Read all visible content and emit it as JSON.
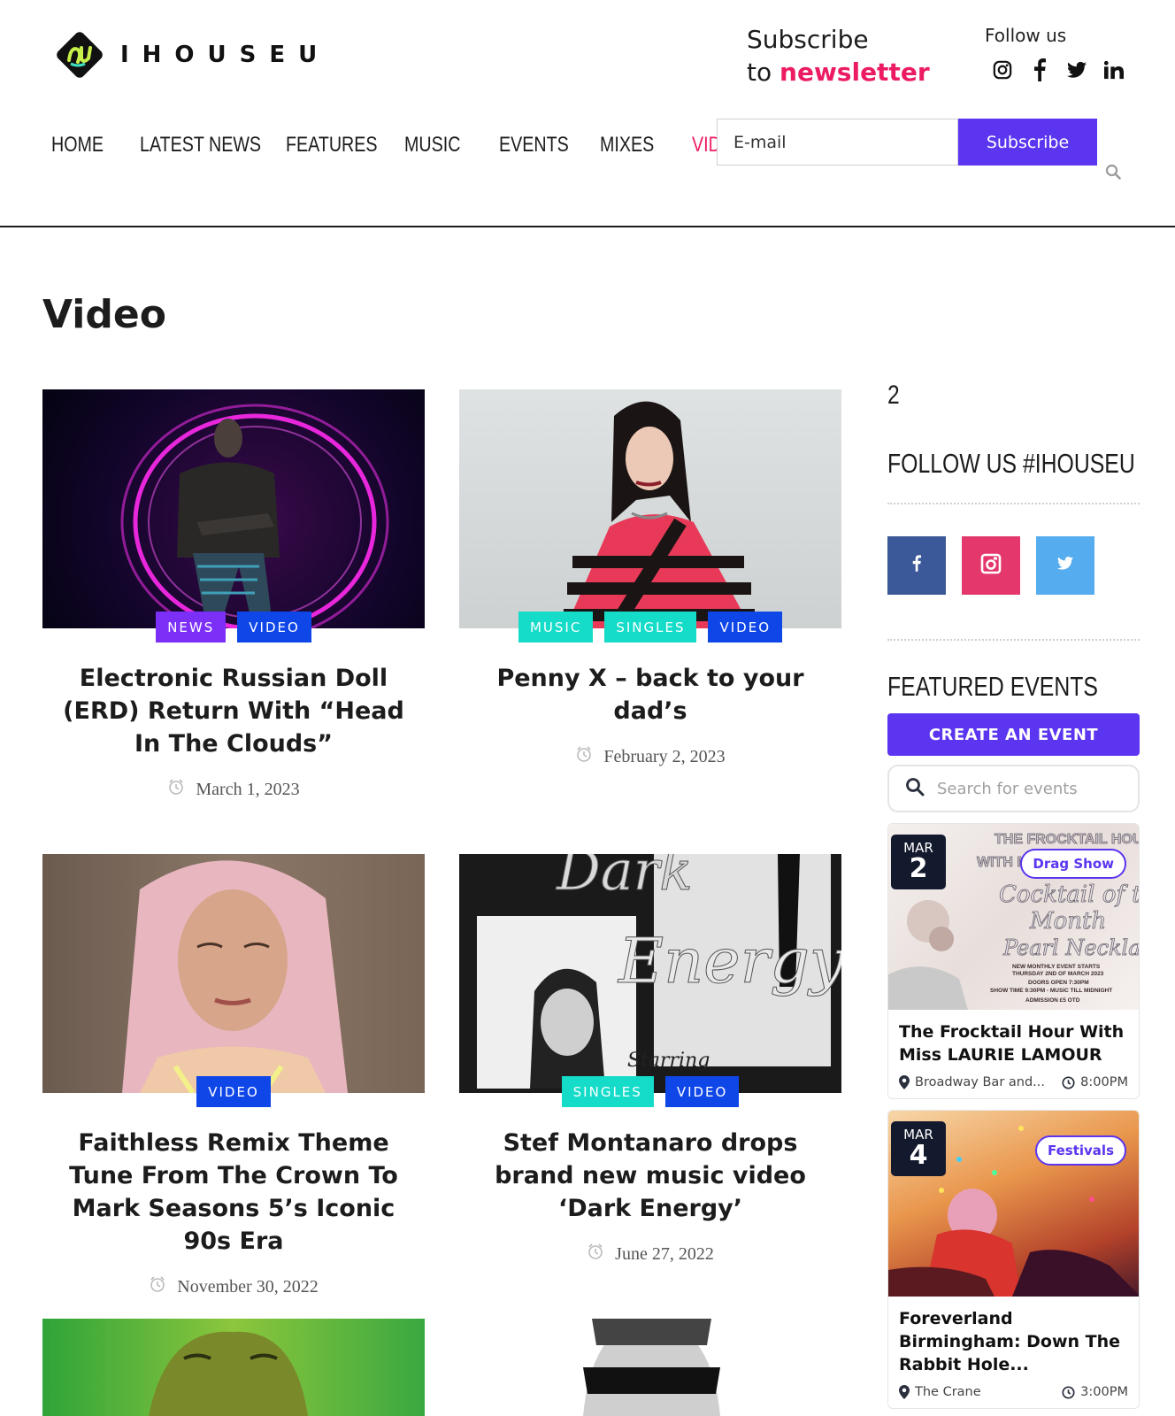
{
  "site": {
    "logo_text": "IHOUSEU"
  },
  "newsletter": {
    "line1": "Subscribe",
    "line2_prefix": "to ",
    "line2_accent": "newsletter",
    "email_placeholder": "E-mail",
    "button_label": "Subscribe"
  },
  "follow": {
    "label": "Follow us",
    "icons": [
      "instagram-icon",
      "facebook-icon",
      "twitter-icon",
      "linkedin-icon"
    ]
  },
  "nav": {
    "items": [
      "HOME",
      "LATEST NEWS",
      "FEATURES",
      "MUSIC",
      "EVENTS",
      "MIXES",
      "VID"
    ],
    "active": "VID"
  },
  "page": {
    "title": "Video"
  },
  "articles": [
    {
      "title": "Electronic Russian Doll (ERD) Return With “Head In The Clouds”",
      "date": "March 1, 2023",
      "tags": [
        "NEWS",
        "VIDEO"
      ]
    },
    {
      "title": "Penny X – back to your dad’s",
      "date": "February 2, 2023",
      "tags": [
        "MUSIC",
        "SINGLES",
        "VIDEO"
      ]
    },
    {
      "title": "Faithless Remix Theme Tune From The Crown To Mark Seasons 5’s Iconic 90s Era",
      "date": "November 30, 2022",
      "tags": [
        "VIDEO"
      ]
    },
    {
      "title": "Stef Montanaro drops brand new music video ‘Dark Energy’",
      "date": "June 27, 2022",
      "tags": [
        "SINGLES",
        "VIDEO"
      ]
    }
  ],
  "image_overlay_text": {
    "dark_energy_1": "Dark",
    "dark_energy_2": "Energy",
    "starring": "Starring"
  },
  "sidebar": {
    "number": "2",
    "follow_heading": "FOLLOW US #IHOUSEU",
    "featured_heading": "FEATURED EVENTS",
    "create_event_label": "CREATE AN EVENT",
    "search_placeholder": "Search for events",
    "events": [
      {
        "month": "MAR",
        "day": "2",
        "category": "Drag Show",
        "title": "The Frocktail Hour With Miss LAURIE LAMOUR",
        "venue": "Broadway Bar and...",
        "time": "8:00PM",
        "poster": {
          "l1": "THE FROCKTAIL HOUR",
          "l2": "WITH MI",
          "l3": "Cocktail of the",
          "l4": "Month",
          "l5": "Pearl Necklace",
          "l6": "NEW MONTHLY EVENT STARTS",
          "l7": "THURSDAY 2ND OF MARCH 2023",
          "l8": "DOORS OPEN 7:30PM",
          "l9": "SHOW TIME 9:30PM - MUSIC TILL MIDNIGHT",
          "l10": "ADMISSION £5 OTD"
        }
      },
      {
        "month": "MAR",
        "day": "4",
        "category": "Festivals",
        "title": "Foreverland Birmingham: Down The Rabbit Hole...",
        "venue": "The Crane",
        "time": "3:00PM"
      }
    ]
  },
  "colors": {
    "accent_pink": "#ec1b63",
    "primary_purple": "#5b35f0",
    "tag_blue": "#0f46e8",
    "tag_purple": "#7b2ff7",
    "tag_teal": "#14dcc8"
  }
}
